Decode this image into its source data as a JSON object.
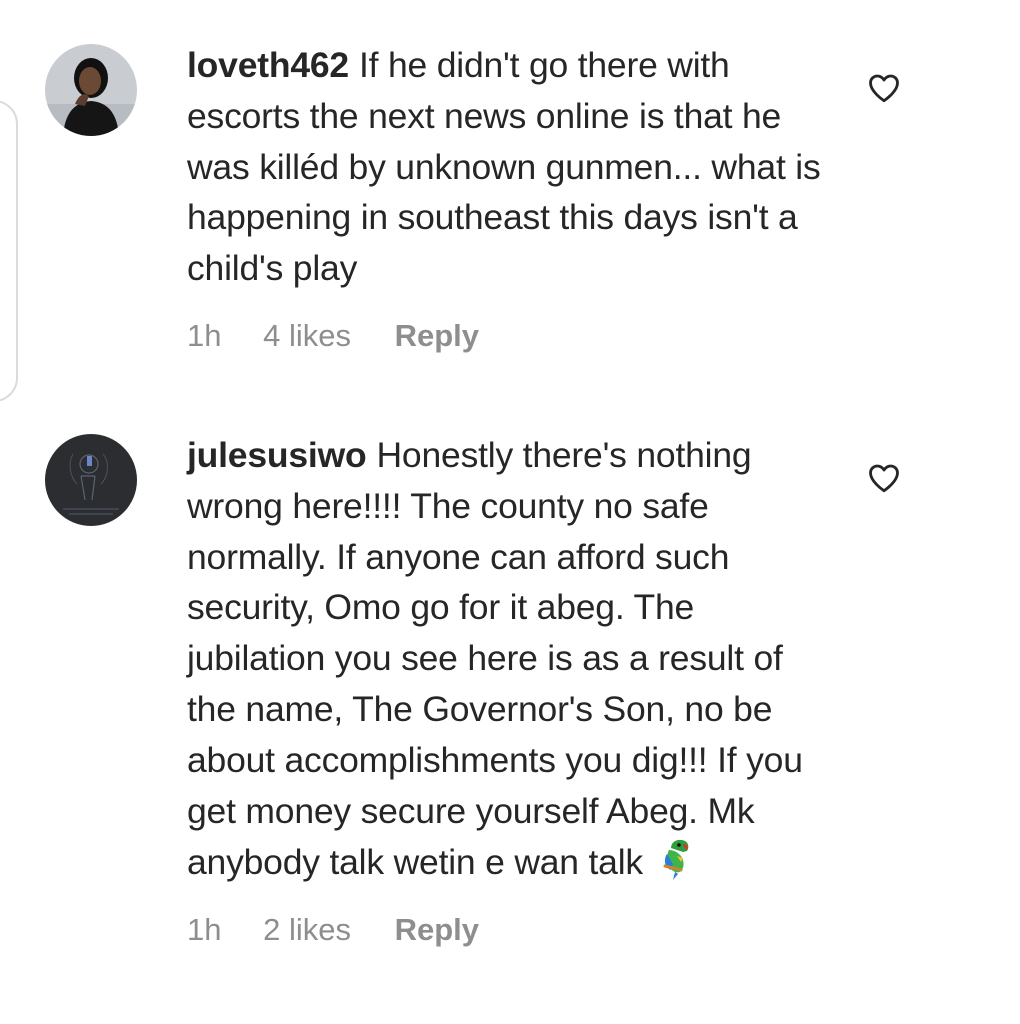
{
  "comments": [
    {
      "username": "loveth462",
      "text": "If he didn't go there with escorts the next news online is that he was killéd by unknown gunmen... what is happening in southeast this days isn't a child's play",
      "time": "1h",
      "likes": "4 likes",
      "reply_label": "Reply"
    },
    {
      "username": "julesusiwo",
      "text": "Honestly there's nothing wrong here!!!! The county no safe normally. If anyone can afford such security, Omo go for it abeg. The jubilation you see here is as a result of the name, The Governor's Son, no be about accomplishments you dig!!! If you get money secure yourself Abeg. Mk anybody talk wetin e wan talk",
      "emoji": "parrot-emoji",
      "time": "1h",
      "likes": "2 likes",
      "reply_label": "Reply"
    }
  ],
  "icons": {
    "like": "heart-outline-icon",
    "avatar_1": "profile-photo",
    "avatar_2": "profile-photo-dark"
  },
  "colors": {
    "text": "#262626",
    "meta": "#8e8e8e",
    "border": "#dbdbdb"
  }
}
